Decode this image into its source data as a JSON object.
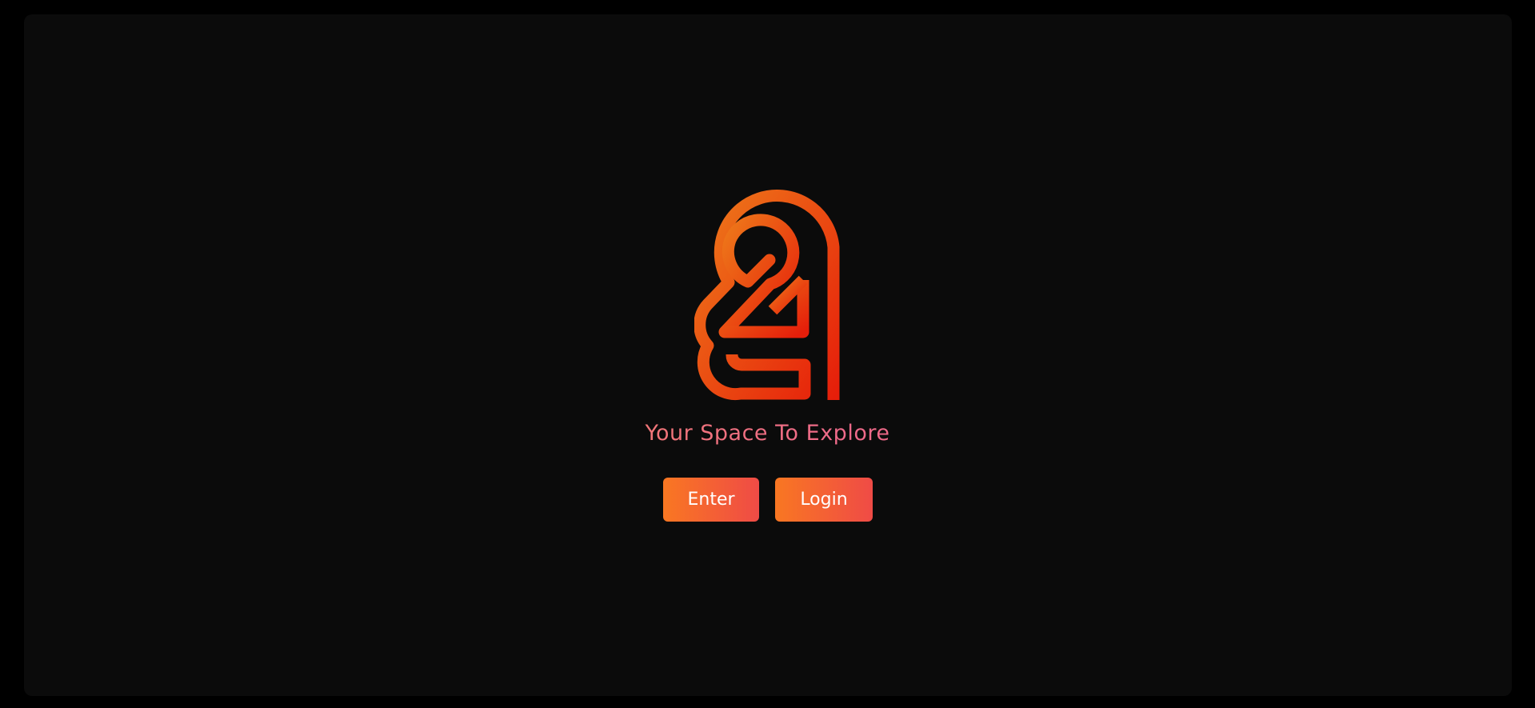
{
  "logo": {
    "icon": "stylized-24-logo-icon",
    "gradient_start": "#ee7a1a",
    "gradient_end": "#e61e0a"
  },
  "tagline": "Your Space To Explore",
  "buttons": {
    "enter_label": "Enter",
    "login_label": "Login",
    "gradient_start": "#f97722",
    "gradient_end": "#ef4b46"
  }
}
